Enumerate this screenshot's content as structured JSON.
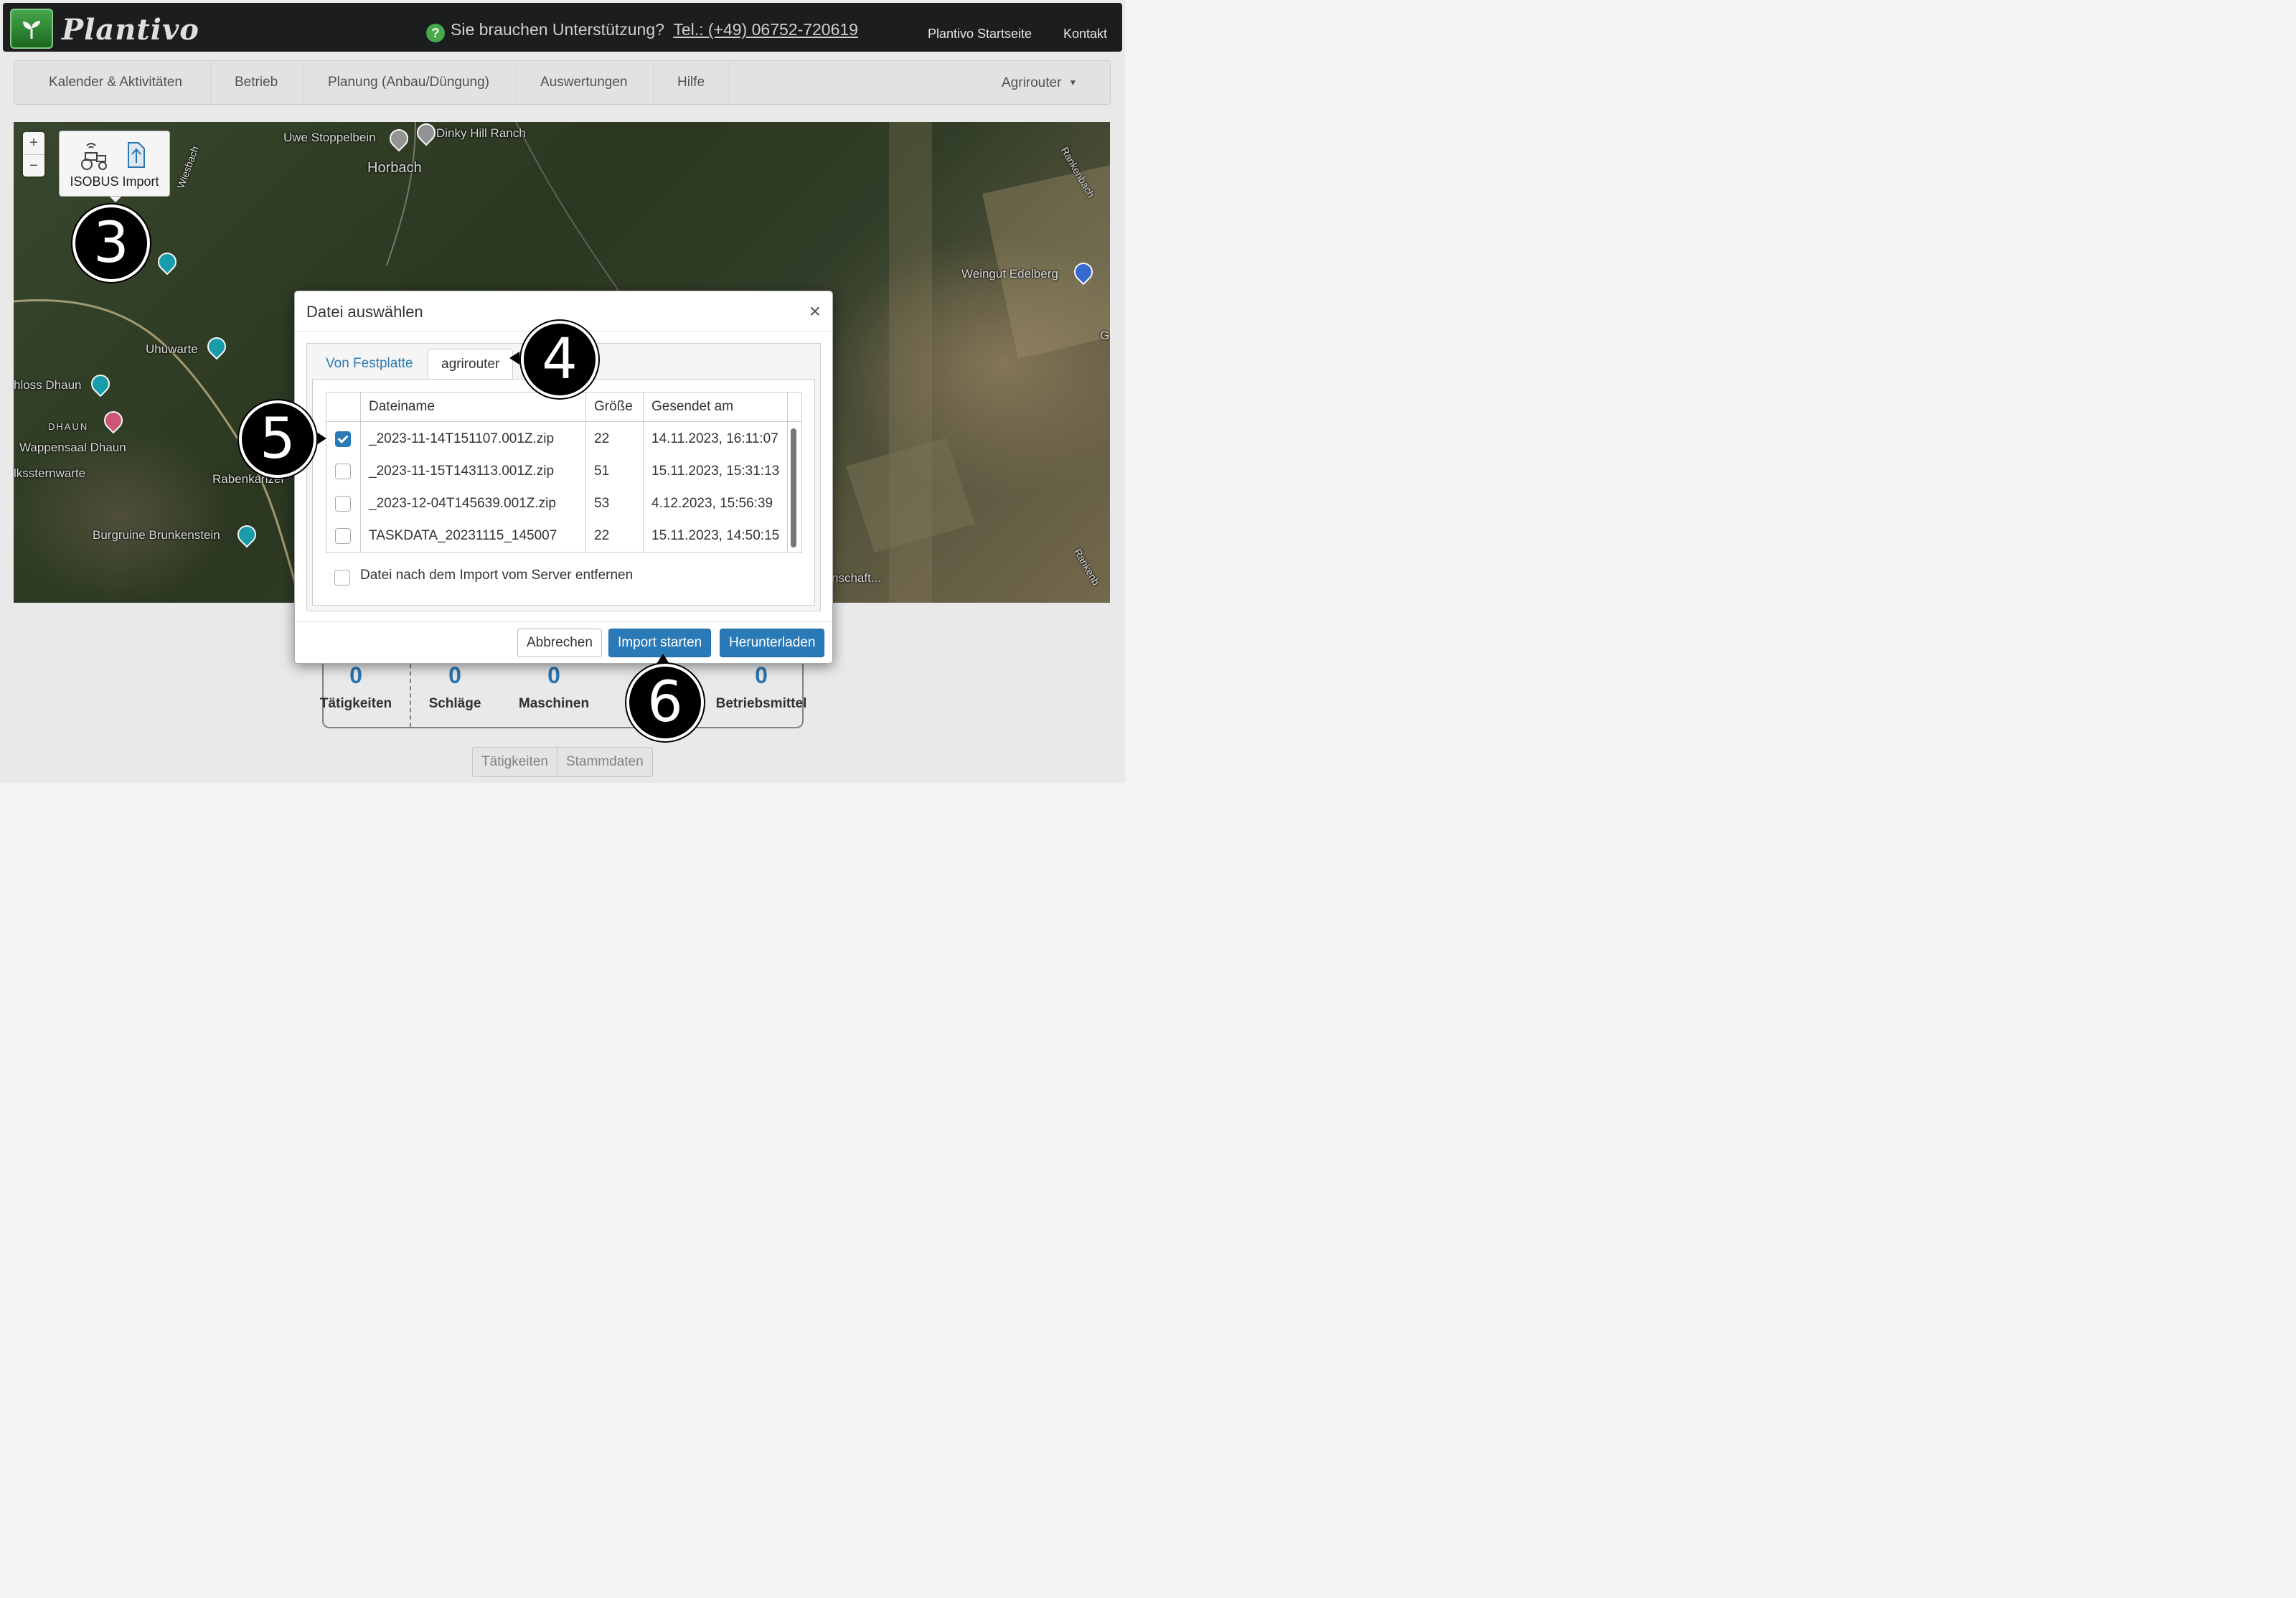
{
  "header": {
    "brand": "Plantivo",
    "support_text": "Sie brauchen Unterstützung?",
    "phone": "Tel.: (+49) 06752-720619",
    "help_icon": "?",
    "links": [
      "Plantivo Startseite",
      "Kontakt"
    ]
  },
  "nav": {
    "items": [
      "Kalender & Aktivitäten",
      "Betrieb",
      "Planung (Anbau/Düngung)",
      "Auswertungen",
      "Hilfe"
    ],
    "agrirouter": "Agrirouter"
  },
  "map": {
    "zoom_in": "+",
    "zoom_out": "−",
    "isobus_label": "ISOBUS Import",
    "labels": {
      "stoppelbein": "Uwe Stoppelbein",
      "dinky": "Dinky Hill Ranch",
      "horbach": "Horbach",
      "wiesbach": "Wiesbach",
      "rankenbach": "Rankenbach",
      "rankenbach2": "Rankenb",
      "weingut": "Weingut Edelberg",
      "uhuwarte": "Uhuwarte",
      "schloss": "hloss Dhaun",
      "dhaun": "DHAUN",
      "wappensaal": "Wappensaal Dhaun",
      "sternwarte": "lkssternwarte",
      "rabenkanzel": "Rabenkanzel",
      "burgruine": "Burgruine Brunkenstein",
      "kel": "el",
      "nschaft": "nschaft...",
      "g": "G"
    }
  },
  "modal": {
    "title": "Datei auswählen",
    "close": "×",
    "tabs": [
      "Von Festplatte",
      "agrirouter"
    ],
    "columns": [
      "Dateiname",
      "Größe",
      "Gesendet am"
    ],
    "rows": [
      {
        "name": "_2023-11-14T151107.001Z.zip",
        "size": "22",
        "sent": "14.11.2023, 16:11:07",
        "checked": true
      },
      {
        "name": "_2023-11-15T143113.001Z.zip",
        "size": "51",
        "sent": "15.11.2023, 15:31:13",
        "checked": false
      },
      {
        "name": "_2023-12-04T145639.001Z.zip",
        "size": "53",
        "sent": "4.12.2023, 15:56:39",
        "checked": false
      },
      {
        "name": "TASKDATA_20231115_145007",
        "size": "22",
        "sent": "15.11.2023, 14:50:15",
        "checked": false
      }
    ],
    "remove_label": "Datei nach dem Import vom Server entfernen",
    "buttons": {
      "cancel": "Abbrechen",
      "import": "Import starten",
      "download": "Herunterladen"
    }
  },
  "counters": [
    {
      "value": "0",
      "label": "Tätigkeiten"
    },
    {
      "value": "0",
      "label": "Schläge"
    },
    {
      "value": "0",
      "label": "Maschinen"
    },
    {
      "value": "0",
      "label": "Betriebsmittel"
    }
  ],
  "bottom_tabs": [
    "Tätigkeiten",
    "Stammdaten"
  ],
  "callouts": [
    "3",
    "4",
    "5",
    "6"
  ],
  "colors": {
    "accent": "#2a7ab8",
    "topbar": "#1e1f21",
    "brand_green": "#4caf50"
  }
}
